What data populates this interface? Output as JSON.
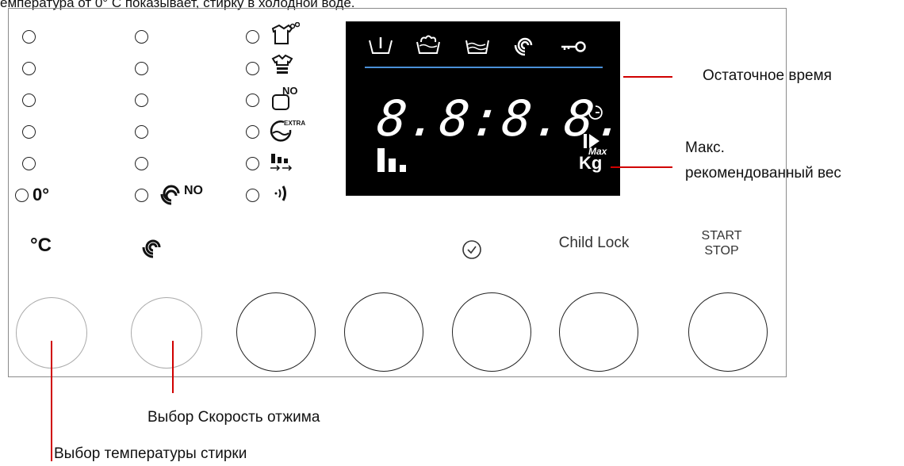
{
  "caption": "емпература от 0° С показывает, стирку в холодной воде.",
  "left_panel": {
    "temp_label": "0°",
    "temp_symbol": "°C",
    "spin_label_no": "NO"
  },
  "icons": {
    "program_icon_labels": [
      "NO",
      "EXTRA"
    ]
  },
  "display": {
    "digits": "8.8:8.8.",
    "kg": "Kg",
    "max": "Max"
  },
  "buttons": {
    "child_lock": "Child Lock",
    "start": "START",
    "stop": "STOP"
  },
  "annotations": {
    "remaining_time": "Остаточное время",
    "max_weight_line1": "Макс.",
    "max_weight_line2": "рекомендованный вес",
    "spin_select": "Выбор Скорость отжима",
    "temp_select": "Выбор температуры стирки"
  },
  "colors": {
    "display_bg": "#000000",
    "display_line": "#4a90d9",
    "annotation_line": "#d00000"
  }
}
